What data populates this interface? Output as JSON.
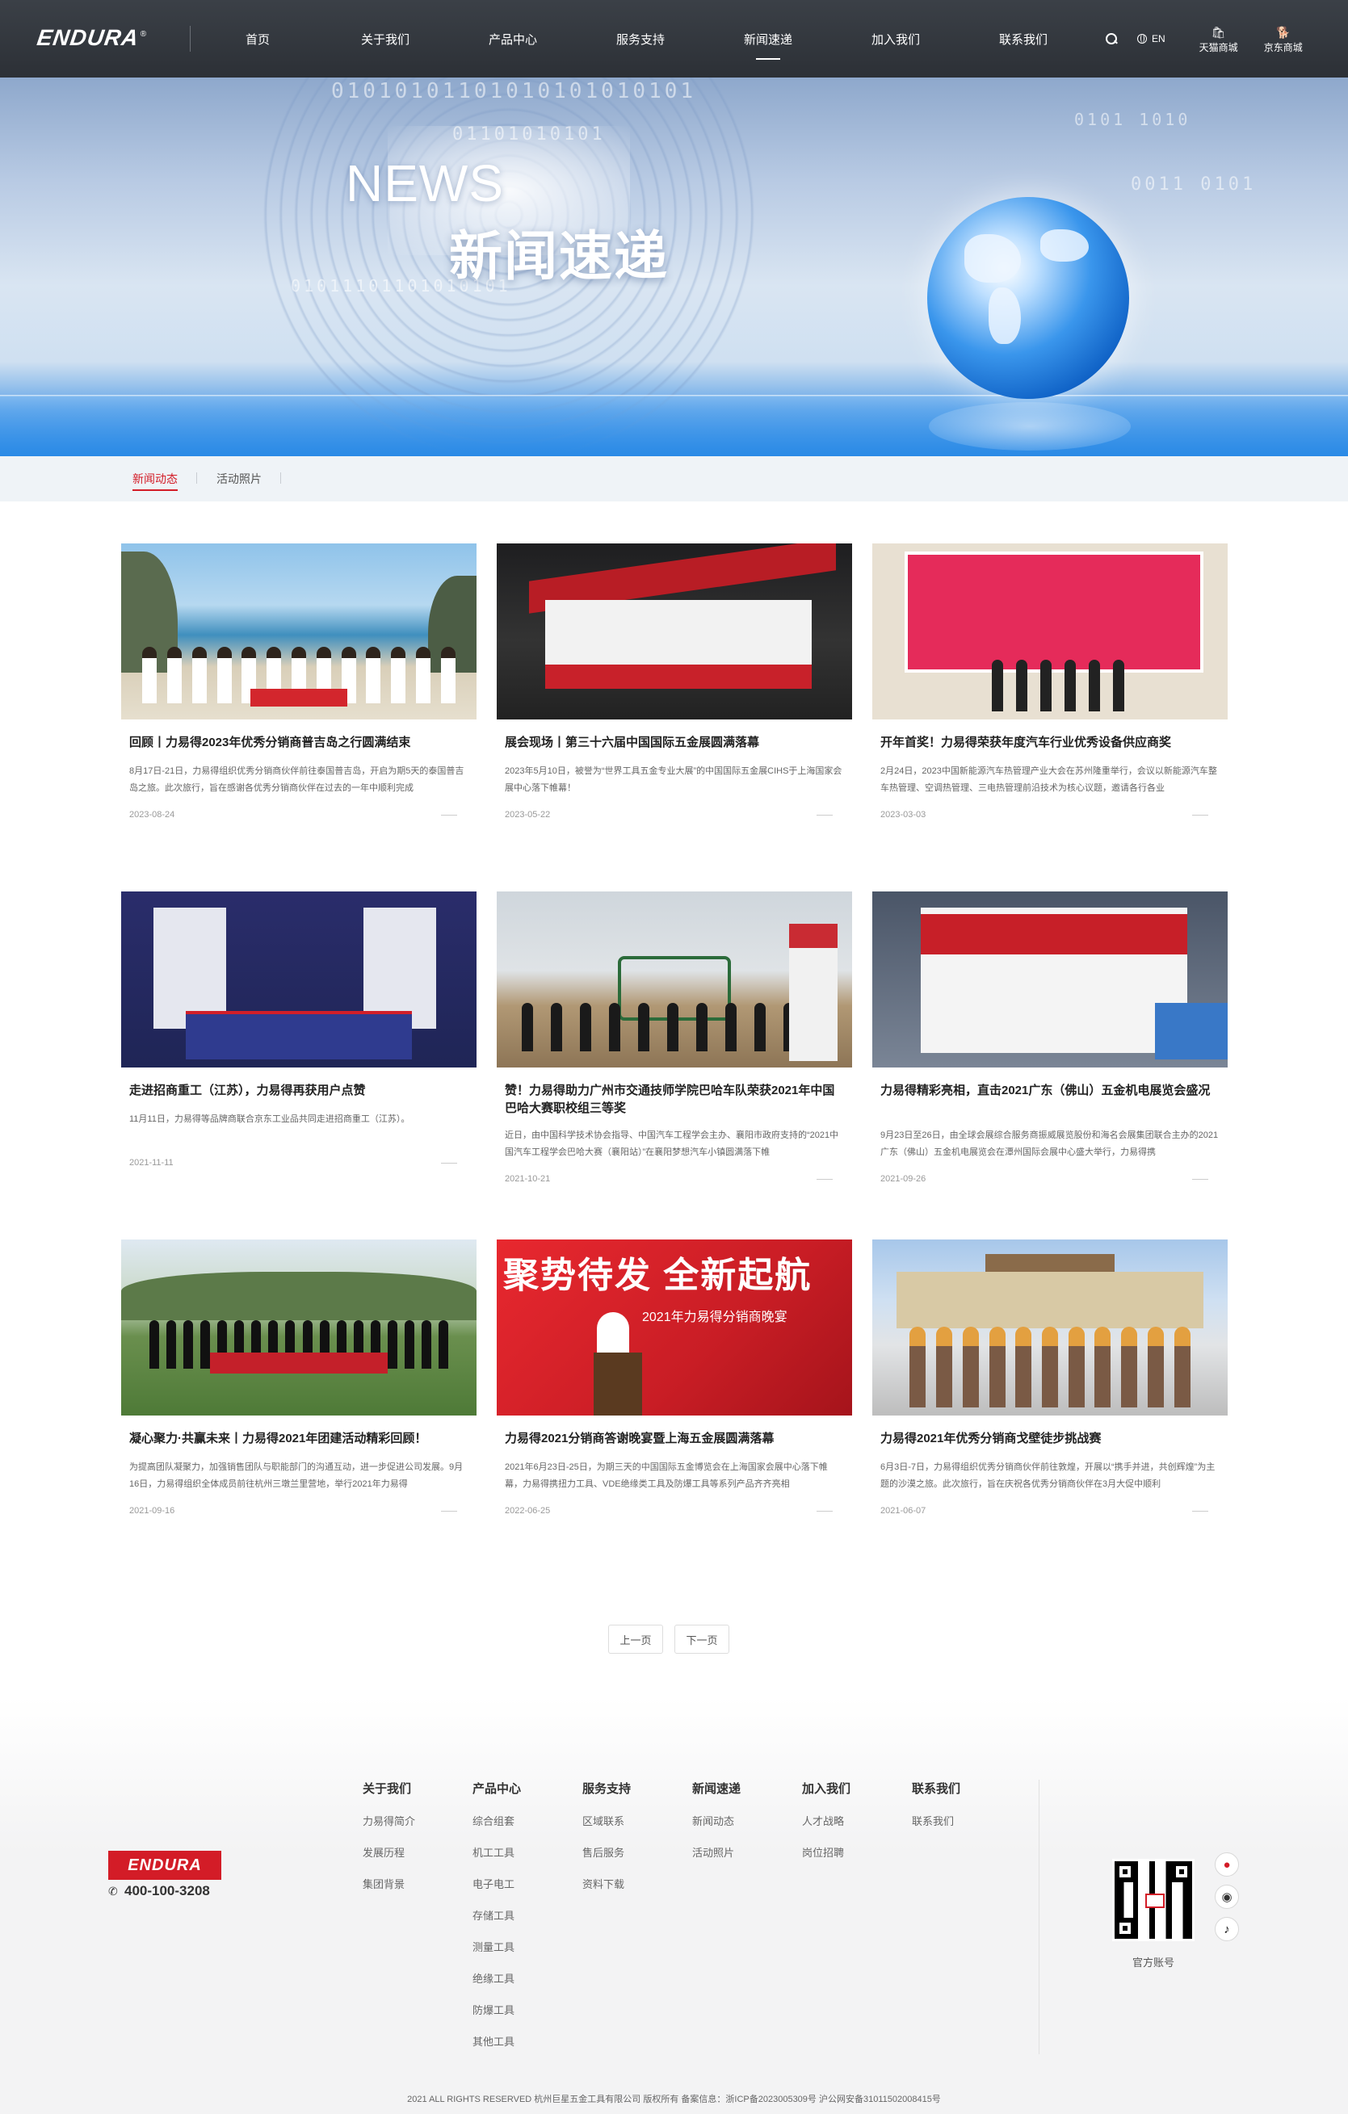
{
  "header": {
    "logo_text": "ENDURA",
    "nav": [
      "首页",
      "关于我们",
      "产品中心",
      "服务支持",
      "新闻速递",
      "加入我们",
      "联系我们"
    ],
    "active_nav": "新闻速递",
    "lang_label": "EN",
    "shops": [
      {
        "label": "天猫商城",
        "icon": "tmall-icon"
      },
      {
        "label": "京东商城",
        "icon": "jd-icon"
      }
    ]
  },
  "banner": {
    "title_en": "NEWS",
    "title_zh": "新闻速递"
  },
  "subnav": {
    "tabs": [
      "新闻动态",
      "活动照片"
    ],
    "active": "新闻动态"
  },
  "news": [
    {
      "title": "回顾丨力易得2023年优秀分销商普吉岛之行圆满结束",
      "desc": "8月17日-21日，力易得组织优秀分销商伙伴前往泰国普吉岛，开启为期5天的泰国普吉岛之旅。此次旅行，旨在感谢各优秀分销商伙伴在过去的一年中顺利完成",
      "date": "2023-08-24"
    },
    {
      "title": "展会现场丨第三十六届中国国际五金展圆满落幕",
      "desc": "2023年5月10日，被誉为“世界工具五金专业大展”的中国国际五金展CIHS于上海国家会展中心落下帷幕！",
      "date": "2023-05-22"
    },
    {
      "title": "开年首奖！力易得荣获年度汽车行业优秀设备供应商奖",
      "desc": "2月24日，2023中国新能源汽车热管理产业大会在苏州隆重举行，会议以新能源汽车整车热管理、空调热管理、三电热管理前沿技术为核心议题，邀请各行各业",
      "date": "2023-03-03"
    },
    {
      "title": "走进招商重工（江苏），力易得再获用户点赞",
      "desc": "11月11日，力易得等品牌商联合京东工业品共同走进招商重工（江苏）。",
      "date": "2021-11-11"
    },
    {
      "title": "赞！力易得助力广州市交通技师学院巴哈车队荣获2021年中国巴哈大赛职校组三等奖",
      "desc": "近日，由中国科学技术协会指导、中国汽车工程学会主办、襄阳市政府支持的“2021中国汽车工程学会巴哈大赛（襄阳站）”在襄阳梦想汽车小镇圆满落下帷",
      "date": "2021-10-21"
    },
    {
      "title": "力易得精彩亮相，直击2021广东（佛山）五金机电展览会盛况",
      "desc": "9月23日至26日，由全球会展综合服务商振威展览股份和海名会展集团联合主办的2021广东（佛山）五金机电展览会在潭州国际会展中心盛大举行，力易得携",
      "date": "2021-09-26"
    },
    {
      "title": "凝心聚力·共赢未来丨力易得2021年团建活动精彩回顾！",
      "desc": "为提高团队凝聚力，加强销售团队与职能部门的沟通互动，进一步促进公司发展。9月16日，力易得组织全体成员前往杭州三墩兰里营地，举行2021年力易得",
      "date": "2021-09-16"
    },
    {
      "title": "力易得2021分销商答谢晚宴暨上海五金展圆满落幕",
      "desc": "2021年6月23日-25日，为期三天的中国国际五金博览会在上海国家会展中心落下帷幕，力易得携扭力工具、VDE绝缘类工具及防爆工具等系列产品齐齐亮相",
      "date": "2022-06-25"
    },
    {
      "title": "力易得2021年优秀分销商戈壁徒步挑战赛",
      "desc": "6月3日-7日，力易得组织优秀分销商伙伴前往敦煌，开展以“携手并进，共创辉煌”为主题的沙漠之旅。此次旅行，旨在庆祝各优秀分销商伙伴在3月大促中顺利",
      "date": "2021-06-07"
    }
  ],
  "pager": {
    "prev": "上一页",
    "next": "下一页"
  },
  "footer": {
    "logo_text": "ENDURA",
    "phone": "400-100-3208",
    "columns": [
      {
        "title": "关于我们",
        "links": [
          "力易得简介",
          "发展历程",
          "集团背景"
        ]
      },
      {
        "title": "产品中心",
        "links": [
          "综合组套",
          "机工工具",
          "电子电工",
          "存储工具",
          "测量工具",
          "绝缘工具",
          "防爆工具",
          "其他工具"
        ]
      },
      {
        "title": "服务支持",
        "links": [
          "区域联系",
          "售后服务",
          "资料下载"
        ]
      },
      {
        "title": "新闻速递",
        "links": [
          "新闻动态",
          "活动照片"
        ]
      },
      {
        "title": "加入我们",
        "links": [
          "人才战略",
          "岗位招聘"
        ]
      },
      {
        "title": "联系我们",
        "links": [
          "联系我们"
        ]
      }
    ],
    "qr_label": "官方账号",
    "social": [
      "weibo-icon",
      "wechat-icon",
      "tiktok-icon"
    ],
    "copyright": "2021 ALL RIGHTS RESERVED 杭州巨星五金工具有限公司  版权所有 备案信息：浙ICP备2023005309号  沪公网安备31011502008415号"
  },
  "colors": {
    "brand_red": "#d31c27",
    "header_bg": "#2f3339",
    "subnav_bg": "#eff3f7",
    "footer_bg": "#f3f3f4"
  }
}
